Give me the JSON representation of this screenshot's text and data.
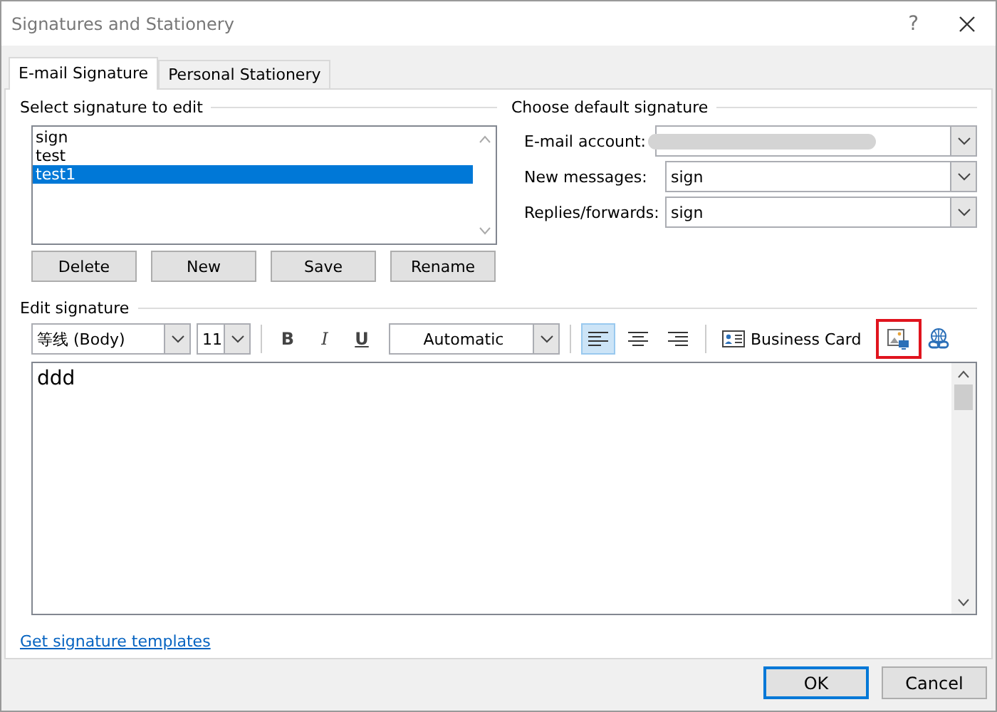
{
  "window": {
    "title": "Signatures and Stationery",
    "help": "?"
  },
  "tabs": [
    {
      "label": "E-mail Signature",
      "selected": true
    },
    {
      "label": "Personal Stationery",
      "selected": false
    }
  ],
  "select_signature": {
    "heading": "Select signature to edit",
    "items": [
      {
        "label": "sign",
        "selected": false
      },
      {
        "label": "test",
        "selected": false
      },
      {
        "label": "test1",
        "selected": true
      }
    ],
    "buttons": [
      "Delete",
      "New",
      "Save",
      "Rename"
    ]
  },
  "default_signature": {
    "heading": "Choose default signature",
    "fields": [
      {
        "label": "E-mail account:",
        "value_redacted": true
      },
      {
        "label": "New messages:",
        "value": "sign"
      },
      {
        "label": "Replies/forwards:",
        "value": "sign"
      }
    ]
  },
  "edit_signature": {
    "heading": "Edit signature",
    "font": "等线 (Body)",
    "size": "11",
    "format_buttons": [
      "B",
      "I",
      "U"
    ],
    "font_color": "Automatic",
    "alignment": [
      {
        "kind": "left",
        "selected": true
      },
      {
        "kind": "center",
        "selected": false
      },
      {
        "kind": "right",
        "selected": false
      }
    ],
    "business_card": "Business Card",
    "picture_button_highlighted": true,
    "text": "ddd"
  },
  "templates_link": "Get signature templates",
  "footer_buttons": [
    {
      "label": "OK",
      "default": true
    },
    {
      "label": "Cancel",
      "default": false
    }
  ]
}
